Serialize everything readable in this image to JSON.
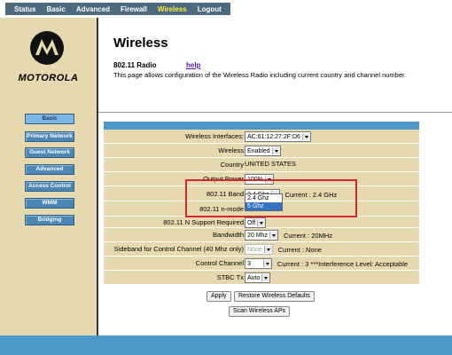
{
  "topnav": {
    "tabs": [
      "Status",
      "Basic",
      "Advanced",
      "Firewall",
      "Wireless",
      "Logout"
    ],
    "active": "Wireless"
  },
  "logo": {
    "brand": "MOTOROLA"
  },
  "sidebar": {
    "buttons": [
      "Basic",
      "Primary Network",
      "Guest Network",
      "Advanced",
      "Access Control",
      "WMM",
      "Bridging"
    ]
  },
  "page": {
    "title": "Wireless",
    "subtitle": "802.11 Radio",
    "help": "help",
    "description": "This page allows configuration of the Wireless Radio including current country and channel number."
  },
  "form": {
    "interfaces": {
      "label": "Wireless Interfaces:",
      "value": "AC:61:12:27:2F:D6"
    },
    "wireless": {
      "label": "Wireless",
      "value": "Enabled"
    },
    "country": {
      "label": "Country",
      "value": "UNITED STATES"
    },
    "power": {
      "label": "Output Power",
      "value": "100%"
    },
    "band": {
      "label": "802.11 Band",
      "value": "2.4 Ghz",
      "current": "Current :  2.4 GHz",
      "options": [
        "2.4 Ghz",
        "5 Ghz"
      ]
    },
    "nmode": {
      "label": "802.11 n-mode"
    },
    "nsupport": {
      "label": "802.11 N Support Required",
      "value": "Off"
    },
    "bandwidth": {
      "label": "Bandwidth",
      "value": "20 Mhz",
      "current": "Current :  20MHz"
    },
    "sideband": {
      "label": "Sideband for Control Channel (40 Mhz only)",
      "value": "None",
      "current": "Current : None"
    },
    "channel": {
      "label": "Control Channel",
      "value": "3",
      "current": "Current :  3  ***Interference Level: Acceptable"
    },
    "stbc": {
      "label": "STBC Tx",
      "value": "Auto"
    }
  },
  "buttons": {
    "apply": "Apply",
    "restore": "Restore Wireless Defaults",
    "scan": "Scan Wireless APs"
  },
  "colors": {
    "nav": "#4d6a7e",
    "accent": "#4d98c8",
    "panel": "#e6d9b0",
    "highlight": "#d6242c"
  }
}
